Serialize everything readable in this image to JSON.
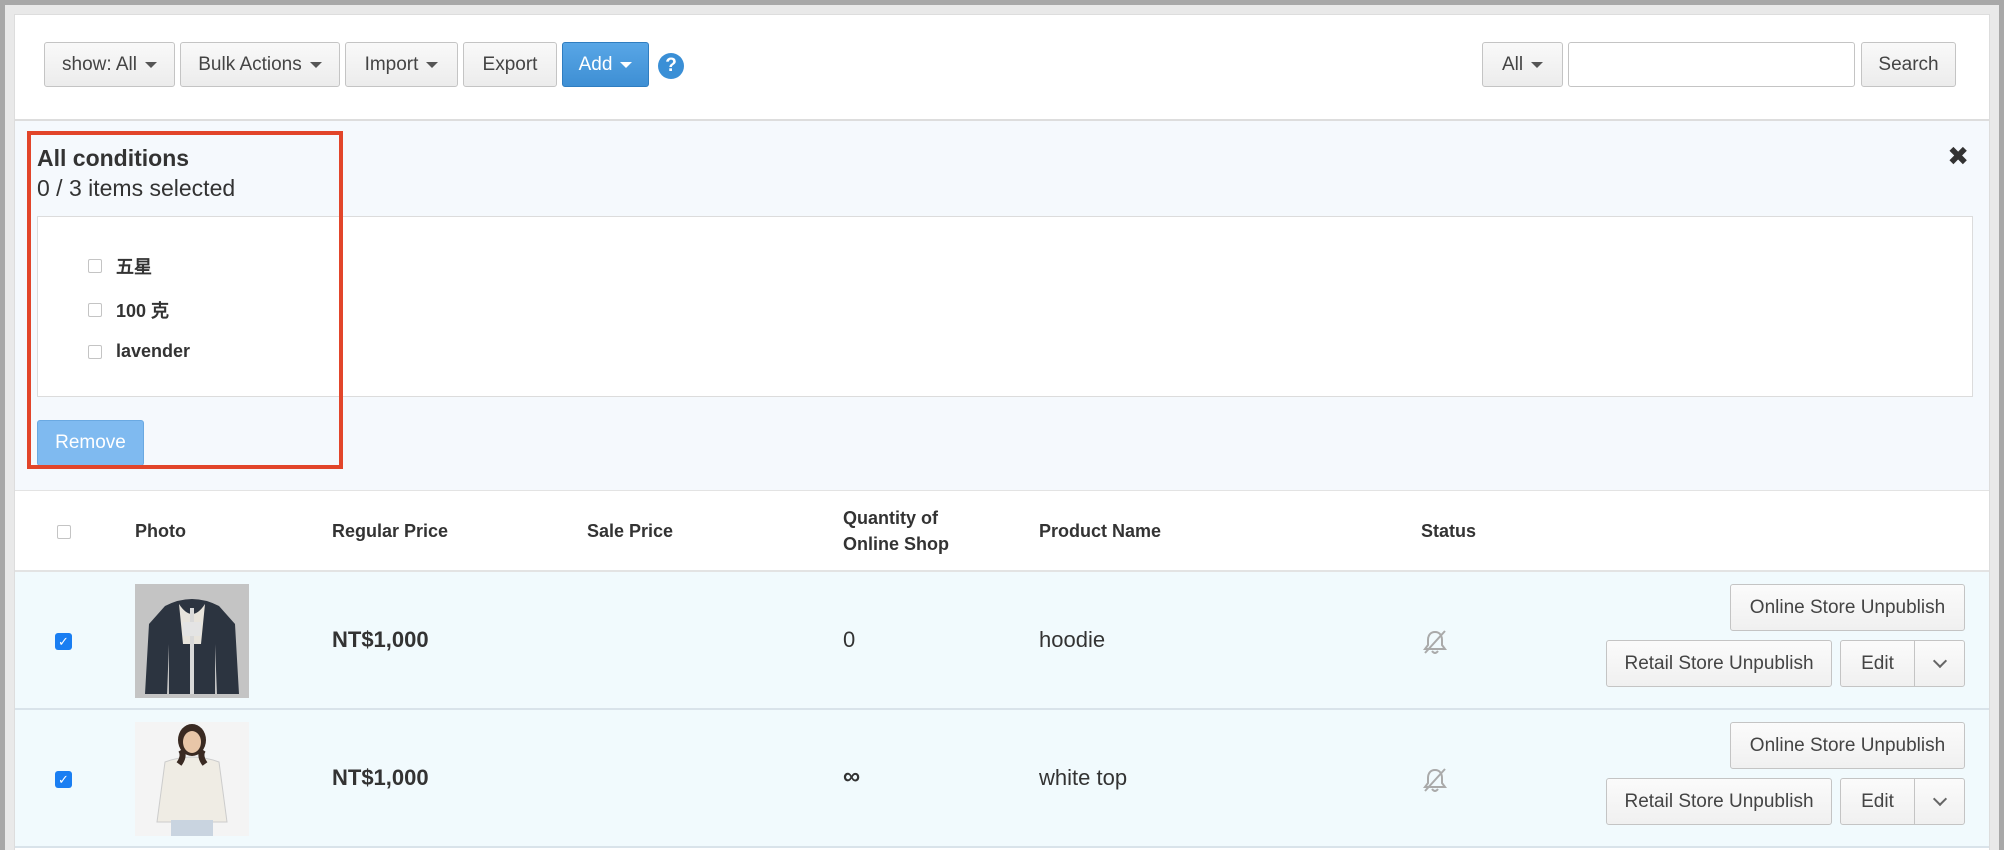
{
  "toolbar": {
    "show_label": "show: All",
    "bulk_label": "Bulk Actions",
    "import_label": "Import",
    "export_label": "Export",
    "add_label": "Add",
    "help_glyph": "?",
    "scope_label": "All",
    "search_value": "",
    "search_label": "Search"
  },
  "filter": {
    "title": "All conditions",
    "count": "0 / 3 items selected",
    "close_glyph": "✖",
    "items": [
      {
        "label": "五星"
      },
      {
        "label": "100 克"
      },
      {
        "label": "lavender"
      }
    ],
    "remove_label": "Remove"
  },
  "table": {
    "headers": {
      "photo": "Photo",
      "regular_price": "Regular Price",
      "sale_price": "Sale Price",
      "qty_line1": "Quantity of",
      "qty_line2": "Online Shop",
      "product_name": "Product Name",
      "status": "Status"
    },
    "rows": [
      {
        "checked": true,
        "photo_icon": "hoodie-photo",
        "regular_price": "NT$1,000",
        "sale_price": "",
        "quantity": "0",
        "product_name": "hoodie",
        "status_icon": "bell-slash-icon",
        "online_unpublish": "Online Store Unpublish",
        "retail_unpublish": "Retail Store Unpublish",
        "edit": "Edit"
      },
      {
        "checked": true,
        "photo_icon": "white-top-photo",
        "regular_price": "NT$1,000",
        "sale_price": "",
        "quantity": "∞",
        "product_name": "white top",
        "status_icon": "bell-slash-icon",
        "online_unpublish": "Online Store Unpublish",
        "retail_unpublish": "Retail Store Unpublish",
        "edit": "Edit"
      }
    ]
  },
  "colors": {
    "primary": "#3e8fd4",
    "highlight": "#e2452a",
    "row_bg": "#f1fafd",
    "checkbox": "#1a7ef2"
  }
}
